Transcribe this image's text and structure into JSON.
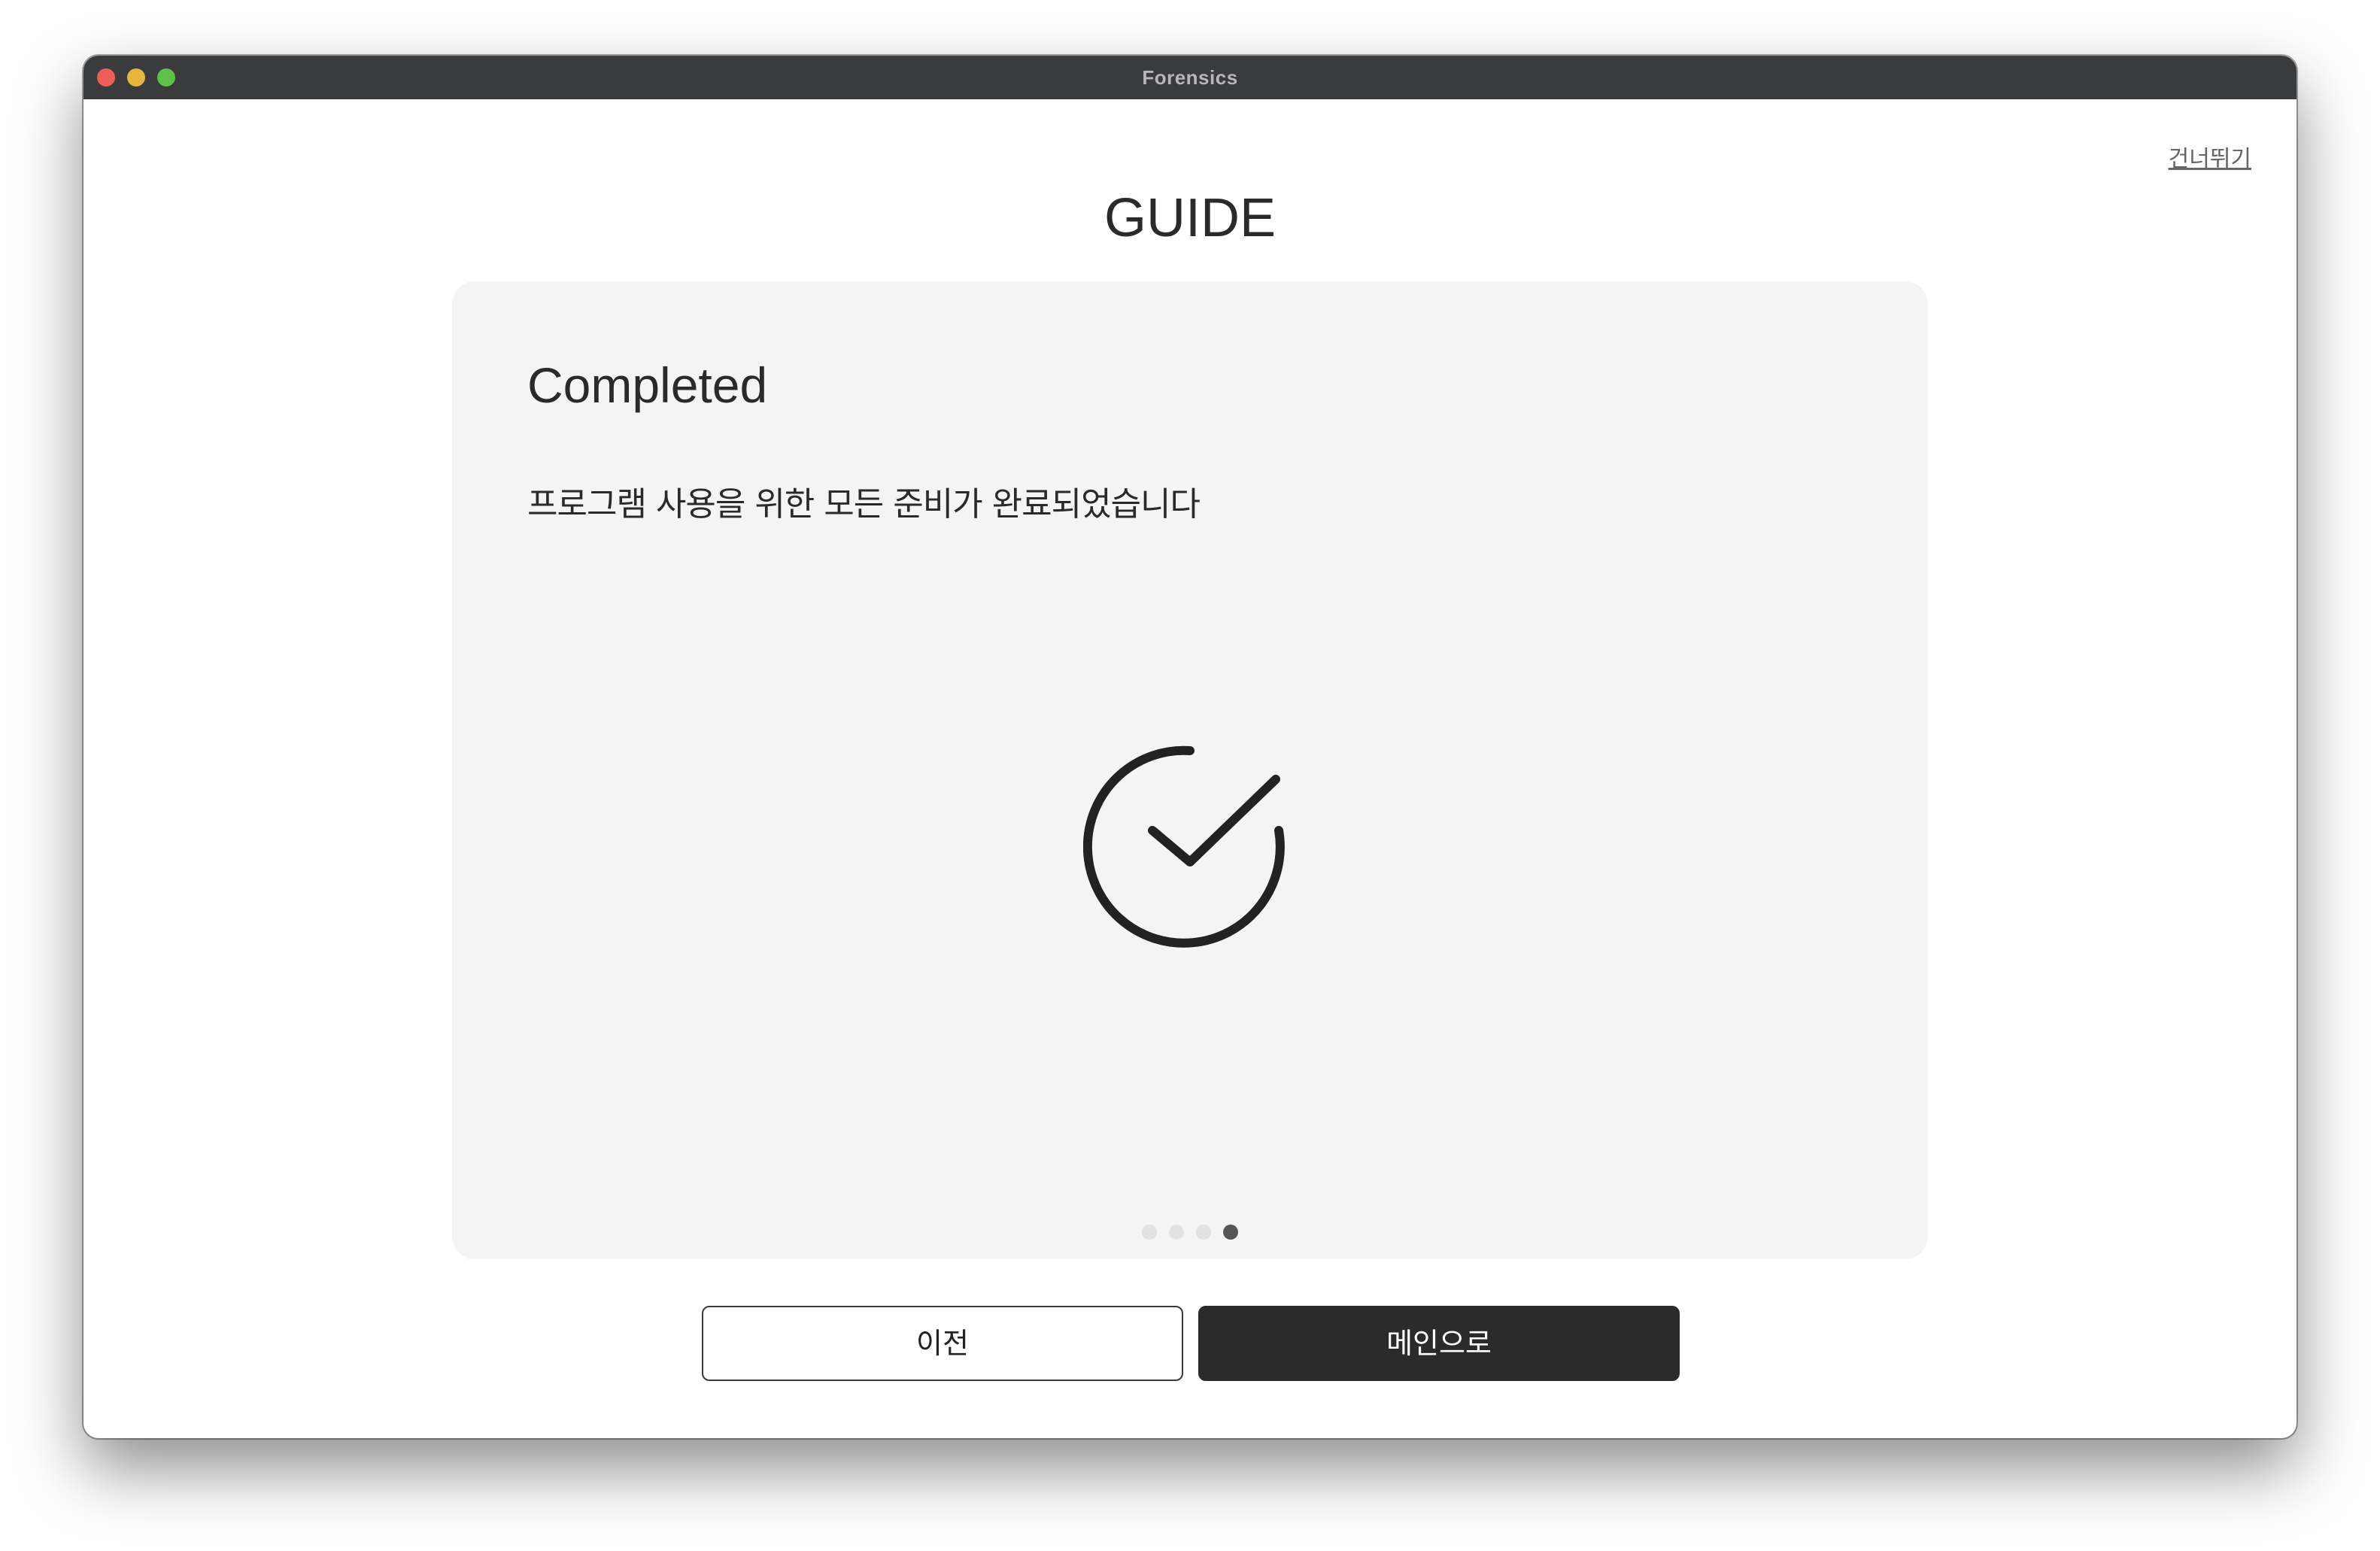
{
  "window": {
    "title": "Forensics"
  },
  "header": {
    "skip_label": "건너뛰기",
    "title": "GUIDE"
  },
  "card": {
    "heading": "Completed",
    "description": "프로그램 사용을 위한 모든 준비가 완료되었습니다",
    "icon": "check-circle-icon"
  },
  "pagination": {
    "total": 4,
    "current": 4
  },
  "buttons": {
    "prev_label": "이전",
    "main_label": "메인으로"
  },
  "colors": {
    "titlebar": "#3a3b3d",
    "card_background": "#f4f4f4",
    "primary_button": "#2b2b2b",
    "dot_active": "#555555",
    "dot_inactive": "#e2e2e2"
  }
}
